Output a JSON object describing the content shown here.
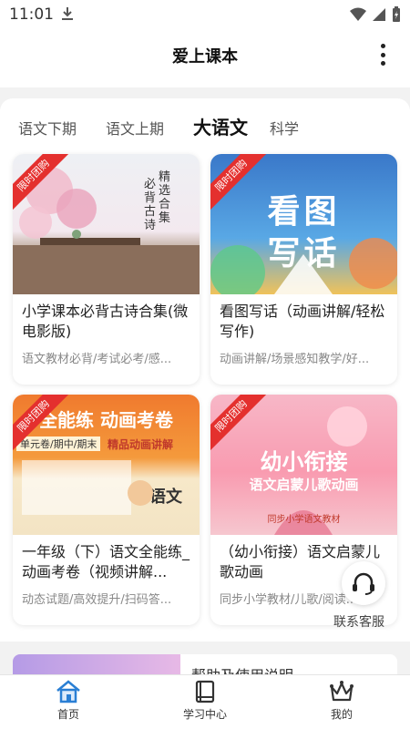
{
  "status_bar": {
    "time": "11:01"
  },
  "header": {
    "title": "爱上课本"
  },
  "tabs": [
    {
      "label": "语文下期"
    },
    {
      "label": "语文上期"
    },
    {
      "label": "大语文"
    },
    {
      "label": "科学"
    }
  ],
  "cards": [
    {
      "ribbon": "限时团购",
      "title": "小学课本必背古诗合集(微电影版)",
      "subtitle": "语文教材必背/考试必考/感...",
      "image_texts": [
        "精选合集",
        "必背古诗"
      ]
    },
    {
      "ribbon": "限时团购",
      "title": "看图写话（动画讲解/轻松写作)",
      "subtitle": "动画讲解/场景感知教学/好...",
      "image_texts": [
        "看图",
        "写话"
      ]
    },
    {
      "ribbon": "限时团购",
      "title": "一年级（下）语文全能练_动画考卷（视频讲解...",
      "subtitle": "动态试题/高效提升/扫码答...",
      "image_texts": [
        "全能练 动画考卷",
        "单元卷/期中/期末",
        "精品动画讲解",
        "语文"
      ]
    },
    {
      "ribbon": "限时团购",
      "title": "（幼小衔接）语文启蒙儿歌动画",
      "subtitle": "同步小学教材/儿歌/阅读...",
      "image_texts": [
        "幼小衔接",
        "语文启蒙儿歌动画",
        "同步小学语文教材"
      ]
    }
  ],
  "floating": {
    "label": "联系客服"
  },
  "help_card": {
    "title": "帮助及使用说明"
  },
  "bottom_nav": [
    {
      "label": "首页"
    },
    {
      "label": "学习中心"
    },
    {
      "label": "我的"
    }
  ],
  "colors": {
    "ribbon": "#e4302e",
    "accent": "#2a7fd4"
  }
}
